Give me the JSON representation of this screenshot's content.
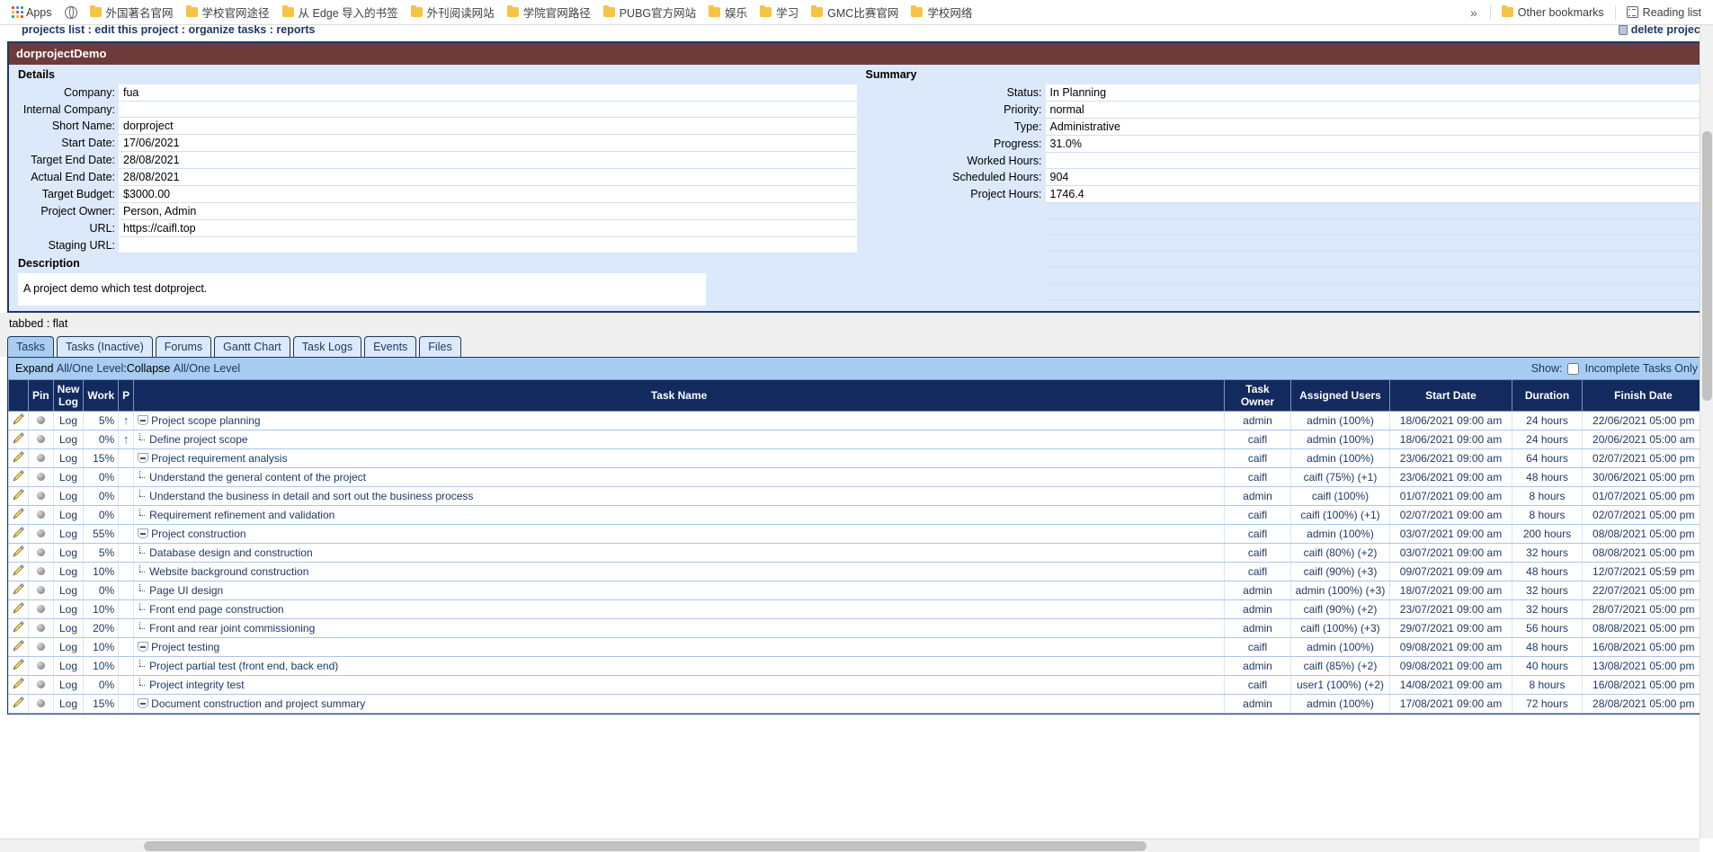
{
  "browser": {
    "apps_label": "Apps",
    "bookmarks": [
      {
        "label": "外国著名官网",
        "icon": "folder-icon"
      },
      {
        "label": "学校官网途径",
        "icon": "folder-icon"
      },
      {
        "label": "从 Edge 导入的书签",
        "icon": "folder-icon"
      },
      {
        "label": "外刊阅读网站",
        "icon": "folder-icon"
      },
      {
        "label": "学院官网路径",
        "icon": "folder-icon"
      },
      {
        "label": "PUBG官方网站",
        "icon": "folder-icon"
      },
      {
        "label": "娱乐",
        "icon": "folder-icon"
      },
      {
        "label": "学习",
        "icon": "folder-icon"
      },
      {
        "label": "GMC比赛官网",
        "icon": "folder-icon"
      },
      {
        "label": "学校网络",
        "icon": "folder-icon"
      }
    ],
    "overflow_label": "»",
    "other_bookmarks": "Other bookmarks",
    "reading_list": "Reading list"
  },
  "breadcrumb": {
    "text": "projects list : edit this project : organize tasks : reports",
    "delete_label": "delete project"
  },
  "project": {
    "title": "dorprojectDemo",
    "details_heading": "Details",
    "details": [
      {
        "label": "Company:",
        "value": "fua"
      },
      {
        "label": "Internal Company:",
        "value": ""
      },
      {
        "label": "Short Name:",
        "value": "dorproject"
      },
      {
        "label": "Start Date:",
        "value": "17/06/2021"
      },
      {
        "label": "Target End Date:",
        "value": "28/08/2021"
      },
      {
        "label": "Actual End Date:",
        "value": "28/08/2021"
      },
      {
        "label": "Target Budget:",
        "value": "$3000.00"
      },
      {
        "label": "Project Owner:",
        "value": "Person, Admin"
      },
      {
        "label": "URL:",
        "value": "https://caifl.top"
      },
      {
        "label": "Staging URL:",
        "value": ""
      }
    ],
    "summary_heading": "Summary",
    "summary": [
      {
        "label": "Status:",
        "value": "In Planning"
      },
      {
        "label": "Priority:",
        "value": "normal"
      },
      {
        "label": "Type:",
        "value": "Administrative"
      },
      {
        "label": "Progress:",
        "value": "31.0%"
      },
      {
        "label": "Worked Hours:",
        "value": ""
      },
      {
        "label": "Scheduled Hours:",
        "value": "904"
      },
      {
        "label": "Project Hours:",
        "value": "1746.4"
      }
    ],
    "description_heading": "Description",
    "description": "A project demo which test dotproject."
  },
  "view_mode": {
    "label": "tabbed : flat",
    "tabbed": "tabbed",
    "separator": " : ",
    "flat": "flat"
  },
  "tabs": [
    {
      "label": "Tasks",
      "active": true
    },
    {
      "label": "Tasks (Inactive)",
      "active": false
    },
    {
      "label": "Forums",
      "active": false
    },
    {
      "label": "Gantt Chart",
      "active": false
    },
    {
      "label": "Task Logs",
      "active": false
    },
    {
      "label": "Events",
      "active": false
    },
    {
      "label": "Files",
      "active": false
    }
  ],
  "toolbar": {
    "expand_label": "Expand",
    "expand_link": "All/One Level",
    "sep": " : ",
    "collapse_label": "Collapse",
    "collapse_link": "All/One Level",
    "show_label": "Show:",
    "incomplete_label": "Incomplete Tasks Only"
  },
  "table": {
    "columns": [
      "",
      "Pin",
      "New Log",
      "Work",
      "P",
      "Task Name",
      "Task Owner",
      "Assigned Users",
      "Start Date",
      "Duration",
      "Finish Date"
    ],
    "col_pin": "Pin",
    "col_newlog_1": "New",
    "col_newlog_2": "Log",
    "col_work": "Work",
    "col_p": "P",
    "col_taskname": "Task Name",
    "col_owner": "Task Owner",
    "col_users": "Assigned Users",
    "col_start": "Start Date",
    "col_duration": "Duration",
    "col_finish": "Finish Date",
    "log_label": "Log",
    "rows": [
      {
        "work": "5%",
        "priority": "up",
        "level": 0,
        "node": "parent",
        "name": "Project scope planning",
        "owner": "admin",
        "users": "admin (100%)",
        "start": "18/06/2021 09:00 am",
        "duration": "24 hours",
        "finish": "22/06/2021 05:00 pm"
      },
      {
        "work": "0%",
        "priority": "up",
        "level": 1,
        "node": "leaf",
        "name": "Define project scope",
        "owner": "caifl",
        "users": "admin (100%)",
        "start": "18/06/2021 09:00 am",
        "duration": "24 hours",
        "finish": "20/06/2021 05:00 am"
      },
      {
        "work": "15%",
        "priority": "",
        "level": 0,
        "node": "parent",
        "name": "Project requirement analysis",
        "owner": "caifl",
        "users": "admin (100%)",
        "start": "23/06/2021 09:00 am",
        "duration": "64 hours",
        "finish": "02/07/2021 05:00 pm"
      },
      {
        "work": "0%",
        "priority": "",
        "level": 1,
        "node": "leaf",
        "name": "Understand the general content of the project",
        "owner": "caifl",
        "users": "caifl (75%) (+1)",
        "start": "23/06/2021 09:00 am",
        "duration": "48 hours",
        "finish": "30/06/2021 05:00 pm"
      },
      {
        "work": "0%",
        "priority": "",
        "level": 1,
        "node": "leaf",
        "name": "Understand the business in detail and sort out the business process",
        "owner": "admin",
        "users": "caifl (100%)",
        "start": "01/07/2021 09:00 am",
        "duration": "8 hours",
        "finish": "01/07/2021 05:00 pm"
      },
      {
        "work": "0%",
        "priority": "",
        "level": 1,
        "node": "leaf",
        "name": "Requirement refinement and validation",
        "owner": "caifl",
        "users": "caifl (100%) (+1)",
        "start": "02/07/2021 09:00 am",
        "duration": "8 hours",
        "finish": "02/07/2021 05:00 pm"
      },
      {
        "work": "55%",
        "priority": "",
        "level": 0,
        "node": "parent",
        "name": "Project construction",
        "owner": "caifl",
        "users": "admin (100%)",
        "start": "03/07/2021 09:00 am",
        "duration": "200 hours",
        "finish": "08/08/2021 05:00 pm"
      },
      {
        "work": "5%",
        "priority": "",
        "level": 1,
        "node": "leaf",
        "name": "Database design and construction",
        "owner": "caifl",
        "users": "caifl (80%) (+2)",
        "start": "03/07/2021 09:00 am",
        "duration": "32 hours",
        "finish": "08/08/2021 05:00 pm"
      },
      {
        "work": "10%",
        "priority": "",
        "level": 1,
        "node": "leaf",
        "name": "Website background construction",
        "owner": "caifl",
        "users": "caifl (90%) (+3)",
        "start": "09/07/2021 09:09 am",
        "duration": "48 hours",
        "finish": "12/07/2021 05:59 pm"
      },
      {
        "work": "0%",
        "priority": "",
        "level": 1,
        "node": "leaf",
        "name": "Page UI design",
        "owner": "admin",
        "users": "admin (100%) (+3)",
        "start": "18/07/2021 09:00 am",
        "duration": "32 hours",
        "finish": "22/07/2021 05:00 pm"
      },
      {
        "work": "10%",
        "priority": "",
        "level": 1,
        "node": "leaf",
        "name": "Front end page construction",
        "owner": "admin",
        "users": "caifl (90%) (+2)",
        "start": "23/07/2021 09:00 am",
        "duration": "32 hours",
        "finish": "28/07/2021 05:00 pm"
      },
      {
        "work": "20%",
        "priority": "",
        "level": 1,
        "node": "leaf",
        "name": "Front and rear joint commissioning",
        "owner": "admin",
        "users": "caifl (100%) (+3)",
        "start": "29/07/2021 09:00 am",
        "duration": "56 hours",
        "finish": "08/08/2021 05:00 pm"
      },
      {
        "work": "10%",
        "priority": "",
        "level": 0,
        "node": "parent",
        "name": "Project testing",
        "owner": "caifl",
        "users": "admin (100%)",
        "start": "09/08/2021 09:00 am",
        "duration": "48 hours",
        "finish": "16/08/2021 05:00 pm"
      },
      {
        "work": "10%",
        "priority": "",
        "level": 1,
        "node": "leaf",
        "name": "Project partial test (front end, back end)",
        "owner": "admin",
        "users": "caifl (85%) (+2)",
        "start": "09/08/2021 09:00 am",
        "duration": "40 hours",
        "finish": "13/08/2021 05:00 pm"
      },
      {
        "work": "0%",
        "priority": "",
        "level": 1,
        "node": "leaf",
        "name": "Project integrity test",
        "owner": "caifl",
        "users": "user1 (100%) (+2)",
        "start": "14/08/2021 09:00 am",
        "duration": "8 hours",
        "finish": "16/08/2021 05:00 pm"
      },
      {
        "work": "15%",
        "priority": "",
        "level": 0,
        "node": "parent",
        "name": "Document construction and project summary",
        "owner": "admin",
        "users": "admin (100%)",
        "start": "17/08/2021 09:00 am",
        "duration": "72 hours",
        "finish": "28/08/2021 05:00 pm"
      }
    ]
  }
}
